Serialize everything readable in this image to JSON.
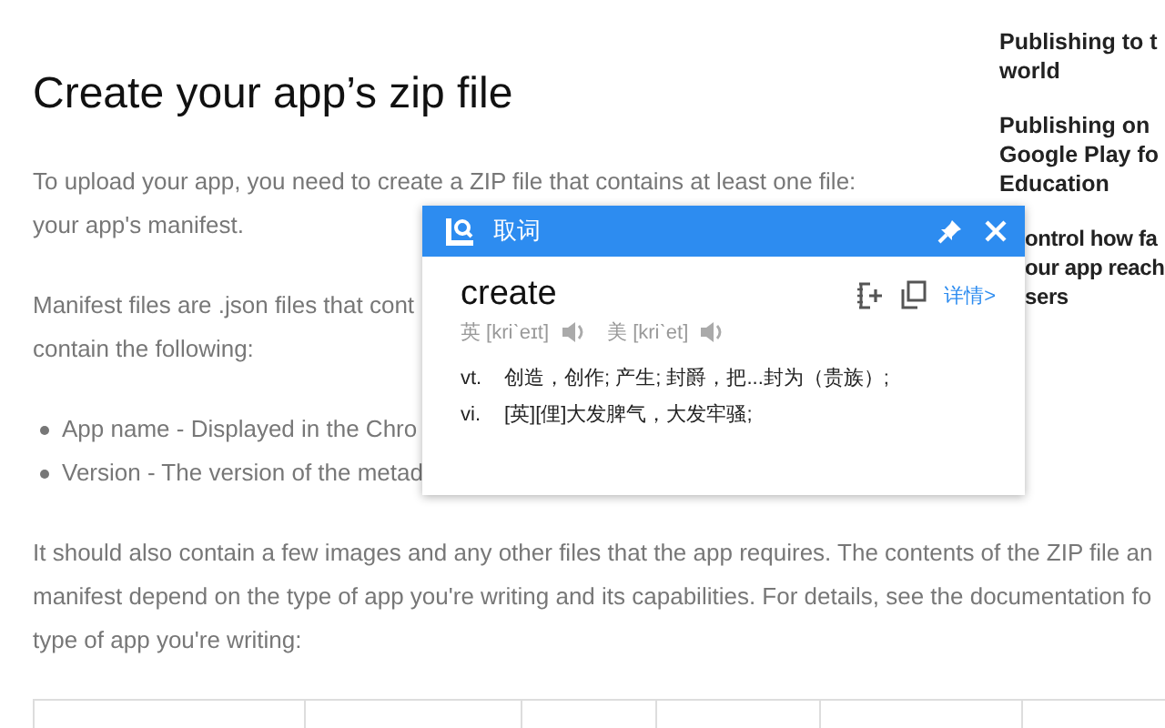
{
  "sidebar": {
    "items": [
      {
        "lines": [
          "Publishing to t",
          "world"
        ]
      },
      {
        "lines": [
          "Publishing on",
          "Google Play fo",
          "Education"
        ]
      },
      {
        "lines": [
          "ontrol how fa",
          "our app reach",
          "sers"
        ]
      }
    ]
  },
  "article": {
    "heading": "Create your app’s zip file",
    "blocks": [
      {
        "kind": "text",
        "lines": [
          "To upload your app, you need to create a ZIP file that contains at least one file:",
          "your app's manifest."
        ]
      },
      {
        "kind": "text",
        "lines": [
          "Manifest files are .json files that cont",
          "contain the following:"
        ]
      },
      {
        "kind": "bullets",
        "lines": [
          "App name - Displayed in the Chro",
          "Version - The version of the metad"
        ]
      },
      {
        "kind": "text",
        "lines": [
          "It should also contain a few images and any other files that the app requires. The contents of the ZIP file an",
          "manifest depend on the type of app you're writing and its capabilities. For details, see the documentation fo",
          "type of app you're writing:"
        ]
      }
    ]
  },
  "popup": {
    "title": "取词",
    "word": "create",
    "details_link": "详情>",
    "phonetics": [
      {
        "region": "英",
        "ipa": "[kriˋeɪt]"
      },
      {
        "region": "美",
        "ipa": "[kriˋet]"
      }
    ],
    "definitions": [
      {
        "pos": "vt.",
        "text": "创造，创作; 产生; 封爵，把...封为（贵族）;"
      },
      {
        "pos": "vi.",
        "text": "[英][俚]大发脾气，大发牢骚;"
      }
    ]
  }
}
